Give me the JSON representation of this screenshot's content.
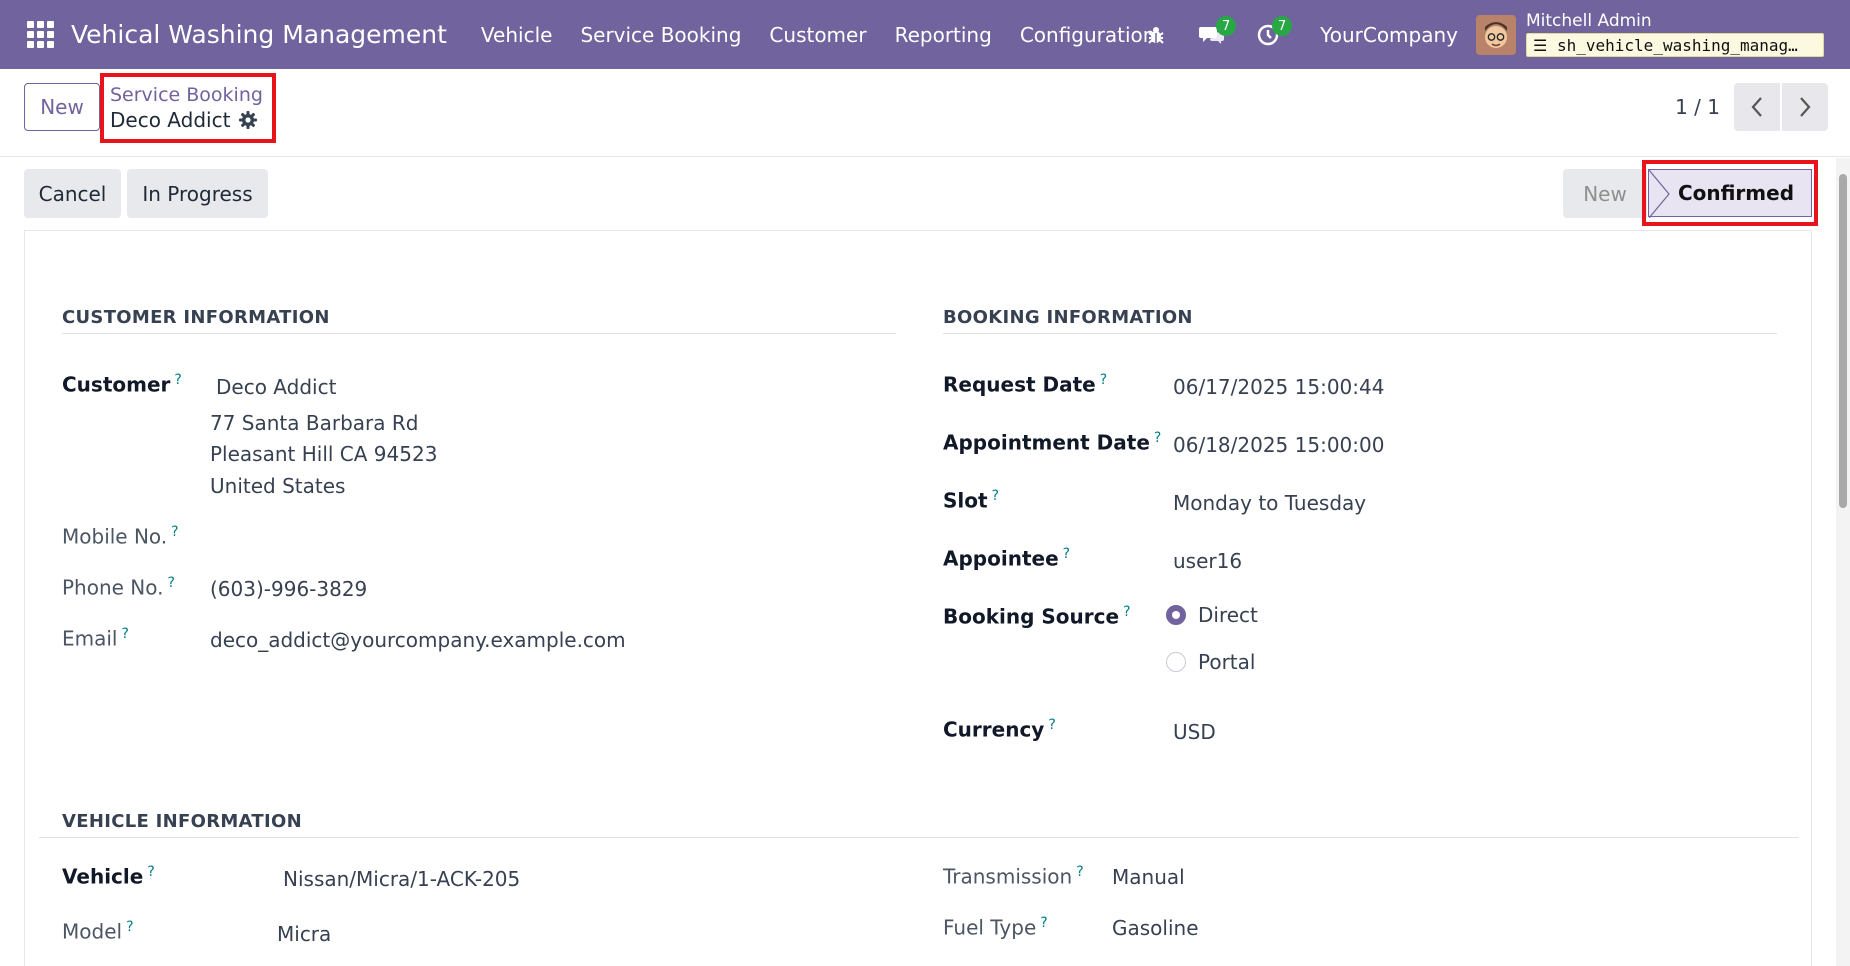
{
  "navbar": {
    "brand": "Vehical Washing Management",
    "menu": [
      "Vehicle",
      "Service Booking",
      "Customer",
      "Reporting",
      "Configuration"
    ],
    "messages_count": "7",
    "activities_count": "7",
    "company": "YourCompany",
    "user_name": "Mitchell Admin",
    "database": "sh_vehicle_washing_manag…"
  },
  "control_panel": {
    "new_label": "New",
    "breadcrumb_parent": "Service Booking",
    "breadcrumb_current": "Deco Addict",
    "pager_value": "1 / 1"
  },
  "statusbar": {
    "cancel_label": "Cancel",
    "in_progress_label": "In Progress",
    "stages": [
      "New",
      "Confirmed"
    ],
    "active_stage": "Confirmed"
  },
  "customer_info": {
    "title": "CUSTOMER INFORMATION",
    "customer_label": "Customer",
    "customer_name": "Deco Addict",
    "address_line1": "77 Santa Barbara Rd",
    "address_line2": "Pleasant Hill CA 94523",
    "address_line3": "United States",
    "mobile_label": "Mobile No.",
    "mobile_value": "",
    "phone_label": "Phone No.",
    "phone_value": "(603)-996-3829",
    "email_label": "Email",
    "email_value": "deco_addict@yourcompany.example.com"
  },
  "booking_info": {
    "title": "BOOKING INFORMATION",
    "request_date_label": "Request Date",
    "request_date_value": "06/17/2025 15:00:44",
    "appointment_date_label": "Appointment Date",
    "appointment_date_value": "06/18/2025 15:00:00",
    "slot_label": "Slot",
    "slot_value": "Monday to Tuesday",
    "appointee_label": "Appointee",
    "appointee_value": "user16",
    "booking_source_label": "Booking Source",
    "booking_source_options": [
      "Direct",
      "Portal"
    ],
    "booking_source_selected": "Direct",
    "currency_label": "Currency",
    "currency_value": "USD"
  },
  "vehicle_info": {
    "title": "VEHICLE INFORMATION",
    "vehicle_label": "Vehicle",
    "vehicle_value": "Nissan/Micra/1-ACK-205",
    "model_label": "Model",
    "model_value": "Micra",
    "transmission_label": "Transmission",
    "transmission_value": "Manual",
    "fuel_type_label": "Fuel Type",
    "fuel_type_value": "Gasoline"
  },
  "help_marker": "?",
  "colors": {
    "navbar": "#71639e",
    "highlight_border": "#e8141b",
    "badge": "#28a745",
    "help_marker": "#017e84"
  }
}
